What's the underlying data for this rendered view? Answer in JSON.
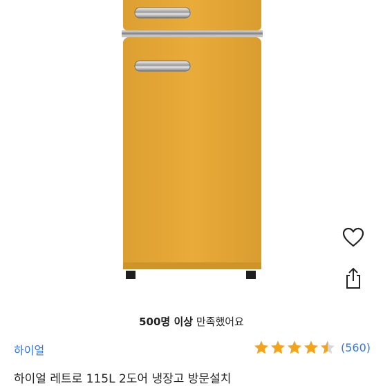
{
  "product_image": {
    "alt": "하이얼 레트로 115L 2도어 냉장고",
    "body_color": "#E7A936"
  },
  "actions": {
    "favorite_icon": "heart-icon",
    "share_icon": "share-icon"
  },
  "satisfaction": {
    "count_text": "500명 이상",
    "suffix_text": "만족했어요"
  },
  "brand": "하이얼",
  "rating": {
    "value": 4.5,
    "max": 5,
    "count_text": "(560)",
    "star_color": "#F2A51A"
  },
  "product_title": "하이얼 레트로 115L 2도어 냉장고 방문설치"
}
